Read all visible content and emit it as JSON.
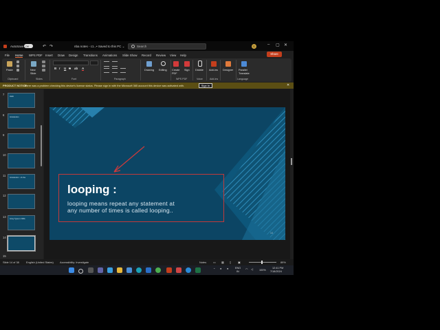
{
  "title_bar": {
    "autosave": "AutoSave",
    "toggle": "Off",
    "doc_name": "nba notes - c1...",
    "saved": "• Saved to this PC ⌄",
    "search_placeholder": "Search",
    "user_initials": "S"
  },
  "menu": {
    "tabs": [
      "File",
      "Home",
      "WPS PDF",
      "Insert",
      "Draw",
      "Design",
      "Transitions",
      "Animations",
      "Slide Show",
      "Record",
      "Review",
      "View",
      "Help"
    ],
    "active": "Home",
    "share": "Share"
  },
  "ribbon": {
    "paste": "Paste",
    "new_slide": "New Slide",
    "drawing": "Drawing",
    "editing": "Editing",
    "create_pdf": "Create PDF",
    "sign": "Sign",
    "dictate": "Dictate",
    "add_ins": "Add-ins",
    "designer": "Designer",
    "translate": "Parallel Translate",
    "groups": [
      "Clipboard",
      "Slides",
      "Font",
      "Paragraph",
      "WPS PDF",
      "Voice",
      "Add-ins",
      "Language"
    ],
    "format_btns": [
      "B",
      "I",
      "U",
      "S",
      "ab",
      "A"
    ]
  },
  "notice": {
    "label": "PRODUCT NOTICE",
    "text": "There was a problem checking this device's license status. Please sign in with the Microsoft 365 account this device was activated with.",
    "button": "Sign In"
  },
  "thumbnails": [
    {
      "num": "7",
      "text": "Hello"
    },
    {
      "num": "8",
      "text": "Introduction"
    },
    {
      "num": "9",
      "text": ""
    },
    {
      "num": "10",
      "text": ""
    },
    {
      "num": "11",
      "text": "Introduction : of nba"
    },
    {
      "num": "12",
      "text": ""
    },
    {
      "num": "13",
      "text": "Array Types in NBA"
    },
    {
      "num": "14",
      "text": ""
    },
    {
      "num": "15",
      "text": ""
    }
  ],
  "selected_slide": "14",
  "slide": {
    "heading": "looping :",
    "body_line1": "looping means repeat any statement at",
    "body_line2": "any number of times is called looping..",
    "page": "14"
  },
  "status": {
    "slide_count": "Slide 14 of 38",
    "language": "English (United States)",
    "accessibility": "Accessibility: Investigate",
    "notes": "Notes",
    "zoom": "89%"
  },
  "tray": {
    "lang": "ENG",
    "lang2": "IN",
    "time": "12:41 PM",
    "date": "7/18/2024",
    "battery": "100%"
  },
  "colors": {
    "accent": "#c43e1c",
    "slide_bg": "#0d4a6a",
    "annotation": "#c43a3a"
  }
}
